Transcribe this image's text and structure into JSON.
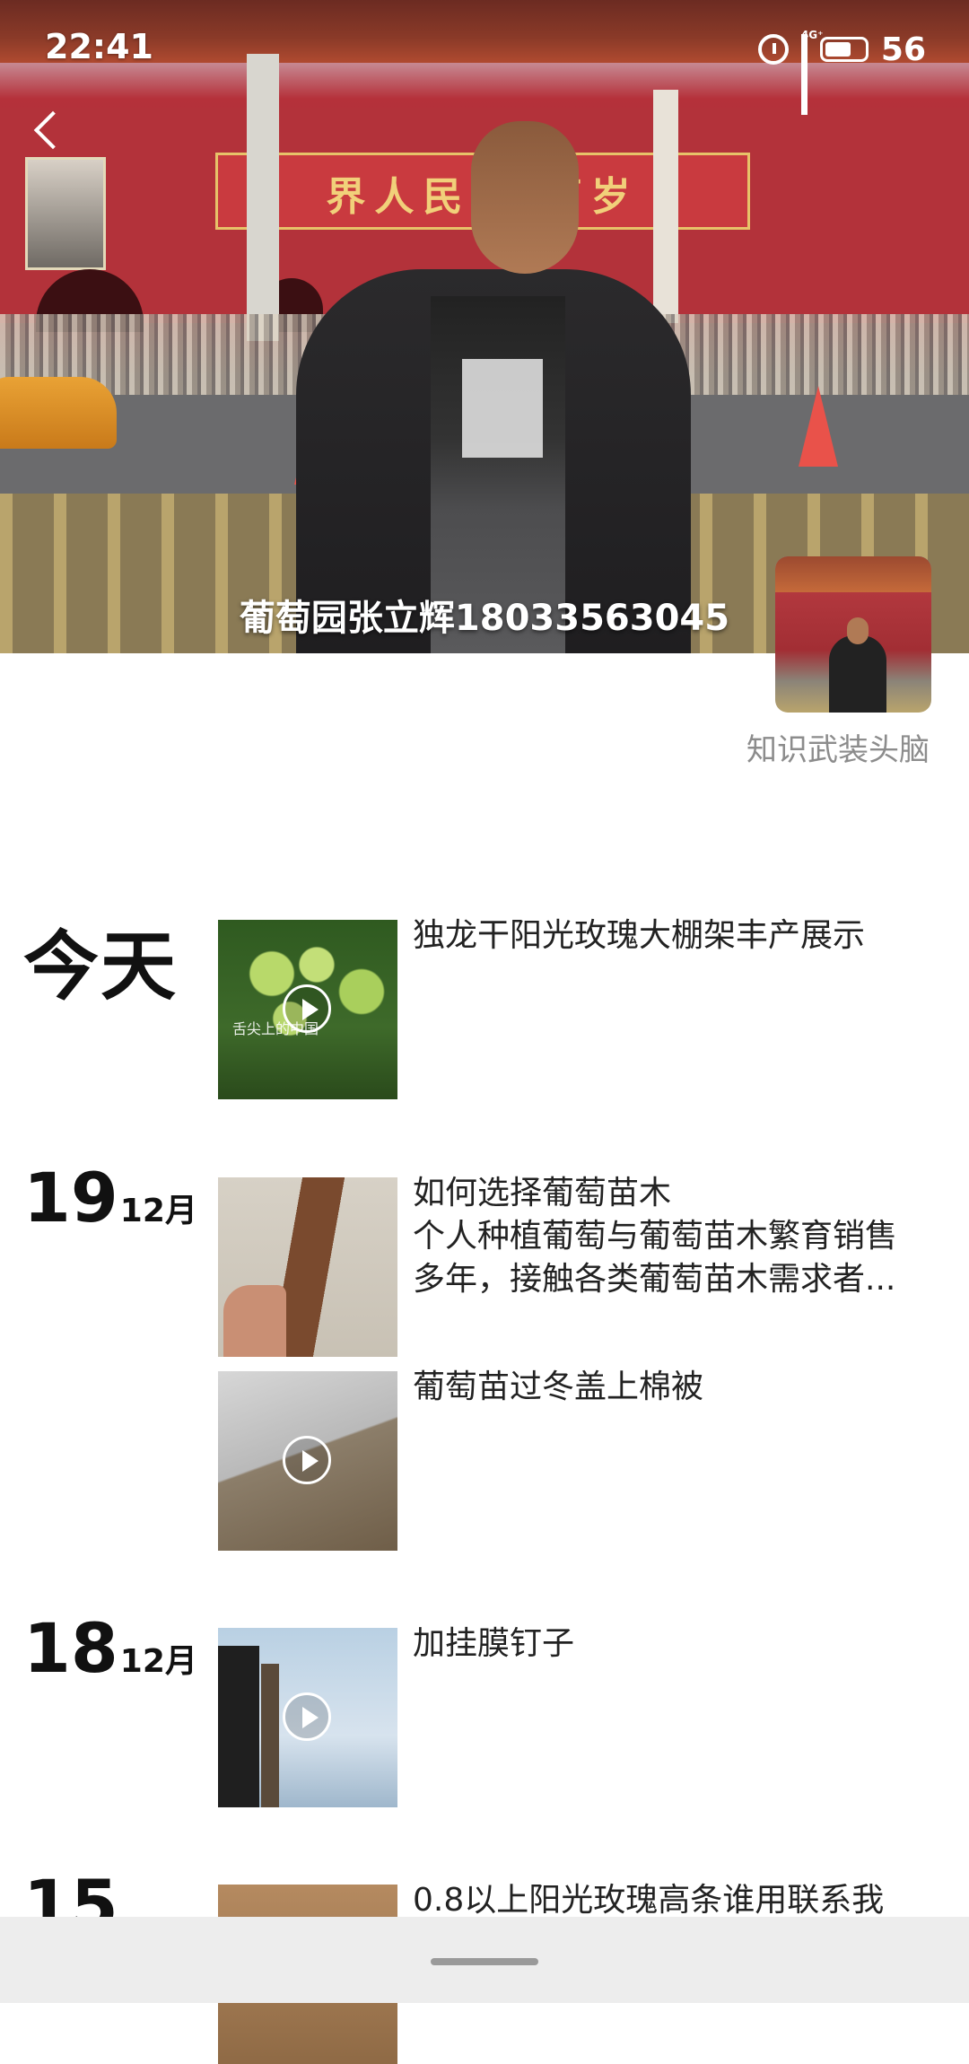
{
  "status_bar": {
    "time": "22:41",
    "network": "4G⁺",
    "battery": "56"
  },
  "profile": {
    "cover_title": "葡萄园张立辉18033563045",
    "nickname": "知识武装头脑",
    "cover_banner_text": "界人民大 万岁"
  },
  "feed": [
    {
      "date_label": "今天",
      "posts": [
        {
          "text_lines": [
            "独龙干阳光玫瑰大棚架丰产展示"
          ],
          "thumb_caption": "舌尖上的中国",
          "video": true
        }
      ]
    },
    {
      "day": "19",
      "month": "12月",
      "posts": [
        {
          "text_lines": [
            "如何选择葡萄苗木",
            "个人种植葡萄与葡萄苗木繁育销售",
            "多年，接触各类葡萄苗木需求者..."
          ],
          "video": false
        },
        {
          "text_lines": [
            "葡萄苗过冬盖上棉被"
          ],
          "video": true
        }
      ]
    },
    {
      "day": "18",
      "month": "12月",
      "posts": [
        {
          "text_lines": [
            "加挂膜钉子"
          ],
          "video": true
        }
      ]
    },
    {
      "day": "15",
      "month": "",
      "posts": [
        {
          "text_lines": [
            "0.8以上阳光玫瑰高条谁用联系我"
          ],
          "video": false
        }
      ]
    }
  ]
}
